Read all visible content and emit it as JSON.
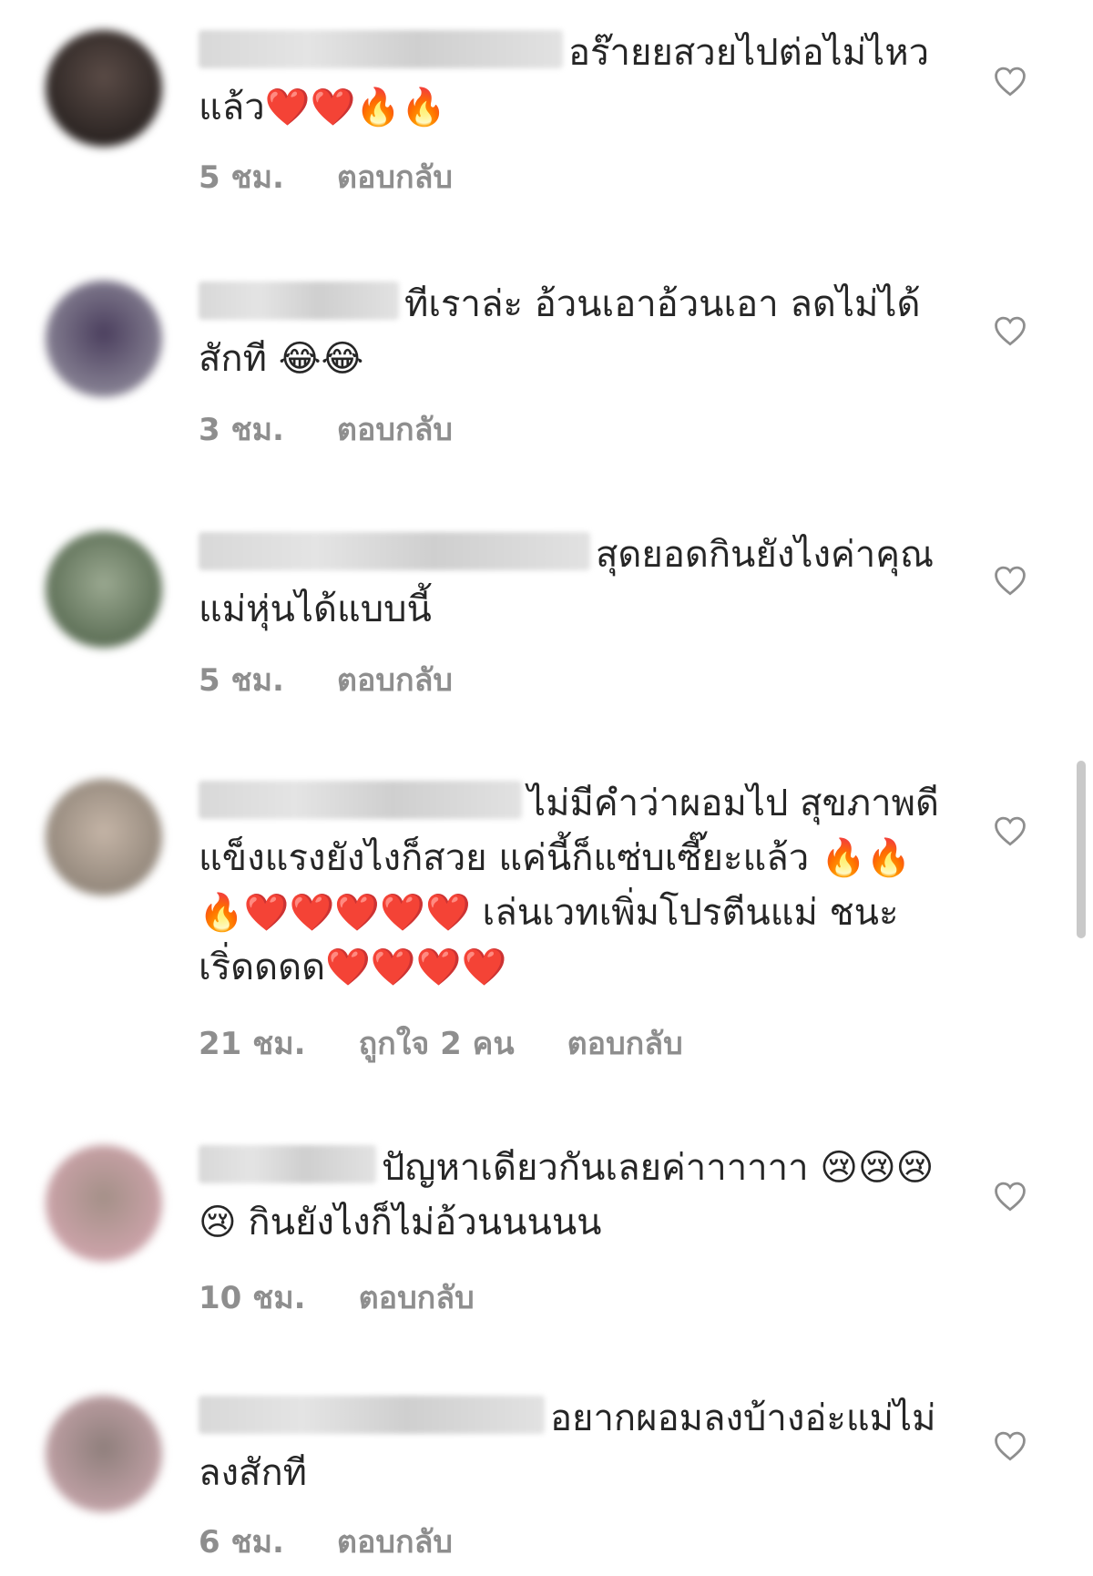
{
  "comments": [
    {
      "text": "อร๊ายยสวยไปต่อไม่ไหวแล้ว❤️❤️🔥🔥",
      "time": "5 ชม.",
      "likes": "",
      "reply": "ตอบกลับ",
      "avatar_color": "#3a3230"
    },
    {
      "text": "ทีเราล่ะ อ้วนเอาอ้วนเอา ลดไม่ได้สักที 😂😂",
      "time": "3 ชม.",
      "likes": "",
      "reply": "ตอบกลับ",
      "avatar_color": "#5d5668"
    },
    {
      "text": "สุดยอดกินยังไงค่าคุณแม่หุ่นได้แบบนี้",
      "time": "5 ชม.",
      "likes": "",
      "reply": "ตอบกลับ",
      "avatar_color": "#6f8067"
    },
    {
      "text": "ไม่มีคำว่าผอมไป สุขภาพดีแข็งแรงยังไงก็สวย แค่นี้ก็แซ่บเซี๊ยะแล้ว 🔥🔥🔥❤️❤️❤️❤️❤️ เล่นเวทเพิ่มโปรตีนแม่ ชนะเริ่ดดดด❤️❤️❤️❤️",
      "time": "21 ชม.",
      "likes": "ถูกใจ 2 คน",
      "reply": "ตอบกลับ",
      "avatar_color": "#9a8c80"
    },
    {
      "text": "ปัญหาเดียวกันเลยค่าาาาาา 😢😢😢😢 กินยังไงก็ไม่อ้วนนนนน",
      "time": "10 ชม.",
      "likes": "",
      "reply": "ตอบกลับ",
      "avatar_color": "#b58f95"
    },
    {
      "text": "อยากผอมลงบ้างอ่ะแม่ไม่ลงสักที",
      "time": "6 ชม.",
      "likes": "",
      "reply": "ตอบกลับ",
      "avatar_color": "#9a8283"
    }
  ]
}
